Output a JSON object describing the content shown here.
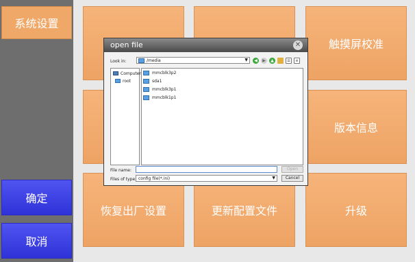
{
  "left_panel": {
    "settings_label": "系统设置",
    "ok_label": "确定",
    "cancel_label": "取消"
  },
  "tiles": {
    "touch_calibration": "触摸屏校准",
    "version_info": "版本信息",
    "factory_reset": "恢复出厂设置",
    "update_config": "更新配置文件",
    "upgrade": "升级"
  },
  "dialog": {
    "title": "open file",
    "look_in_label": "Look in:",
    "look_in_value": "/media",
    "sidebar_items": [
      {
        "label": "Computer",
        "icon": "computer-icon"
      },
      {
        "label": "root",
        "icon": "folder-icon"
      }
    ],
    "files": [
      "mmcblk3p2",
      "sda1",
      "mmcblk3p1",
      "mmcblk1p1"
    ],
    "file_name_label": "File name:",
    "file_name_value": "",
    "files_of_type_label": "Files of type:",
    "files_of_type_value": "config file(*.ini)",
    "open_button": "Open",
    "cancel_button": "Cancel"
  },
  "colors": {
    "tile_orange": "#f0a868",
    "sidebar_gray": "#6e6e6e",
    "button_blue": "#3b3fe8"
  }
}
